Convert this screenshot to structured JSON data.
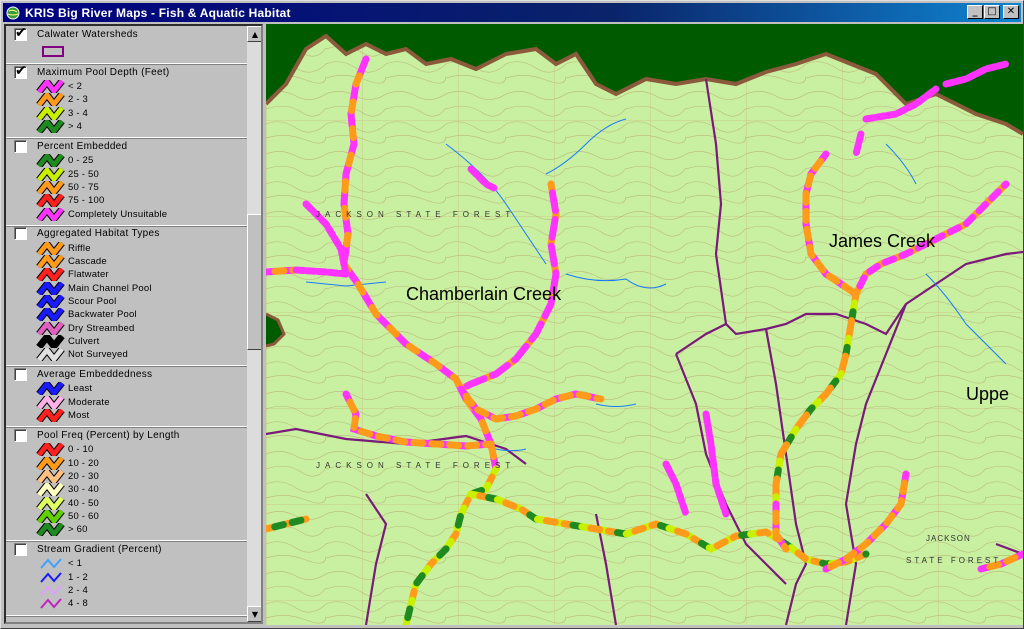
{
  "window": {
    "title": "KRIS Big River Maps - Fish & Aquatic Habitat",
    "buttons": {
      "minimize": "_",
      "maximize": "□",
      "close": "✕"
    }
  },
  "legend": {
    "layers": [
      {
        "title": "Calwater Watersheds",
        "checked": true,
        "symbol": "polygon-outline",
        "color": "#800080",
        "items": []
      },
      {
        "title": "Maximum Pool Depth (Feet)",
        "checked": true,
        "items": [
          {
            "label": "< 2",
            "color": "#ff33ff"
          },
          {
            "label": "2 - 3",
            "color": "#ff9a1a"
          },
          {
            "label": "3 - 4",
            "color": "#c8f000"
          },
          {
            "label": "> 4",
            "color": "#1f8a1f"
          }
        ]
      },
      {
        "title": "Percent Embedded",
        "checked": false,
        "items": [
          {
            "label": "0 - 25",
            "color": "#1f8a1f"
          },
          {
            "label": "25 - 50",
            "color": "#c8f000"
          },
          {
            "label": "50 - 75",
            "color": "#ff9a1a"
          },
          {
            "label": "75 - 100",
            "color": "#ff2020"
          },
          {
            "label": "Completely Unsuitable",
            "color": "#ff33ff"
          }
        ]
      },
      {
        "title": "Aggregated Habitat Types",
        "checked": false,
        "items": [
          {
            "label": "Riffle",
            "color": "#ff9a1a"
          },
          {
            "label": "Cascade",
            "color": "#ff9a1a"
          },
          {
            "label": "Flatwater",
            "color": "#ff2020"
          },
          {
            "label": "Main Channel Pool",
            "color": "#1a1aff"
          },
          {
            "label": "Scour Pool",
            "color": "#1a1aff"
          },
          {
            "label": "Backwater Pool",
            "color": "#1a1aff"
          },
          {
            "label": "Dry Streambed",
            "color": "#e060c0"
          },
          {
            "label": "Culvert",
            "color": "#000000"
          },
          {
            "label": "Not Surveyed",
            "color": "#e0e0e0"
          }
        ]
      },
      {
        "title": "Average Embeddedness",
        "checked": false,
        "items": [
          {
            "label": "Least",
            "color": "#1a1aff"
          },
          {
            "label": "Moderate",
            "color": "#ffb0e8"
          },
          {
            "label": "Most",
            "color": "#ff2020"
          }
        ]
      },
      {
        "title": "Pool Freq (Percent) by Length",
        "checked": false,
        "items": [
          {
            "label": "0 - 10",
            "color": "#ff2020"
          },
          {
            "label": "10 - 20",
            "color": "#ff9a1a"
          },
          {
            "label": "20 - 30",
            "color": "#ffc080"
          },
          {
            "label": "30 - 40",
            "color": "#ffffc0"
          },
          {
            "label": "40 - 50",
            "color": "#e0ff60"
          },
          {
            "label": "50 - 60",
            "color": "#60d000"
          },
          {
            "label": "> 60",
            "color": "#1f8a1f"
          }
        ]
      },
      {
        "title": "Stream Gradient (Percent)",
        "checked": false,
        "items": [
          {
            "label": "< 1",
            "color": "#40a0ff",
            "thin": true
          },
          {
            "label": "1 - 2",
            "color": "#1a1aff",
            "thin": true
          },
          {
            "label": "2 - 4",
            "color": "#e0a0ff",
            "thin": true
          },
          {
            "label": "4 - 8",
            "color": "#c020c0",
            "thin": true
          }
        ]
      }
    ]
  },
  "map": {
    "labels": {
      "chamberlain": "Chamberlain Creek",
      "james": "James Creek",
      "upper": "Uppe",
      "jackson_state_forest_1": "JACKSON STATE FOREST",
      "jackson_state_forest_2": "JACKSON STATE FOREST",
      "jackson_forest_3": "JACKSON",
      "state_forest_3": "STATE FOREST"
    },
    "colors": {
      "background": "#005a00",
      "topo": "#c8f0a0",
      "boundary_outer": "#8b5a3c",
      "watershed": "#7a1a7a",
      "contour": "#c0a070",
      "stream_blue": "#1a7aff"
    }
  }
}
